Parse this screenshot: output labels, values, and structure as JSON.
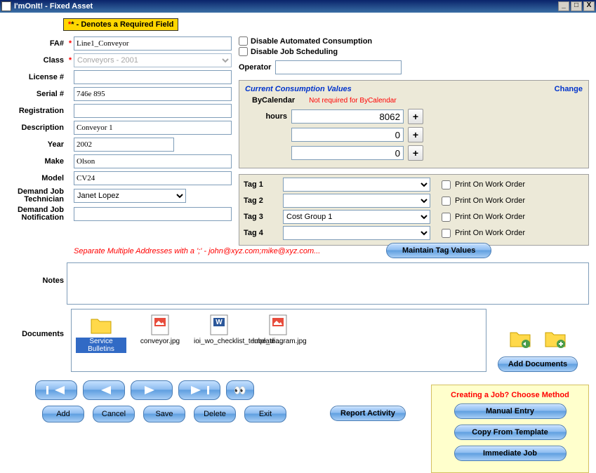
{
  "window": {
    "title": "I'mOnIt! - Fixed Asset"
  },
  "required_note": "* - Denotes a Required Field",
  "fields": {
    "fa_num_label": "FA#",
    "fa_num": "Line1_Conveyor",
    "class_label": "Class",
    "class": "Conveyors - 2001",
    "license_label": "License #",
    "license": "",
    "serial_label": "Serial #",
    "serial": "746e 895",
    "registration_label": "Registration",
    "registration": "",
    "description_label": "Description",
    "description": "Conveyor 1",
    "year_label": "Year",
    "year": "2002",
    "make_label": "Make",
    "make": "Olson",
    "model_label": "Model",
    "model": "CV24",
    "demand_tech_label": "Demand Job Technician",
    "demand_tech": "Janet Lopez",
    "demand_notif_label": "Demand Job Notification",
    "demand_notif": "",
    "hint": "Separate Multiple Addresses with a ';' - john@xyz.com;mike@xyz.com...",
    "notes_label": "Notes",
    "notes": "",
    "documents_label": "Documents"
  },
  "checks": {
    "disable_auto": "Disable Automated Consumption",
    "disable_job": "Disable Job Scheduling"
  },
  "operator_label": "Operator",
  "operator": "",
  "consumption": {
    "title": "Current Consumption Values",
    "change": "Change",
    "bycalendar": "ByCalendar",
    "not_required": "Not required for ByCalendar",
    "hours_label": "hours",
    "values": [
      "8062",
      "0",
      "0"
    ],
    "plus": "+"
  },
  "tags": {
    "labels": [
      "Tag 1",
      "Tag 2",
      "Tag 3",
      "Tag 4"
    ],
    "values": [
      "",
      "",
      "Cost Group 1",
      ""
    ],
    "print_label": "Print On Work Order"
  },
  "maintain_tags": "Maintain Tag Values",
  "documents": [
    {
      "name": "Service Bulletins",
      "type": "folder",
      "selected": true
    },
    {
      "name": "conveyor.jpg",
      "type": "image"
    },
    {
      "name": "ioi_wo_checklist_template....",
      "type": "word"
    },
    {
      "name": "lube_diagram.jpg",
      "type": "image"
    }
  ],
  "add_documents": "Add Documents",
  "actions": {
    "add": "Add",
    "cancel": "Cancel",
    "save": "Save",
    "delete": "Delete",
    "exit": "Exit"
  },
  "report_activity": "Report Activity",
  "job_panel": {
    "title": "Creating a Job? Choose Method",
    "manual": "Manual Entry",
    "copy": "Copy From Template",
    "immediate": "Immediate Job"
  }
}
